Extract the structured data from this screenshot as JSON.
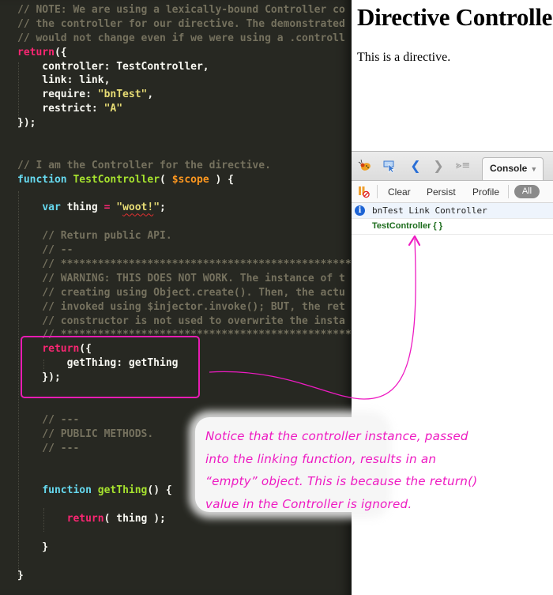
{
  "editor": {
    "lines": [
      [
        {
          "t": "// NOTE: We are using a lexically-bound Controller co",
          "k": "c"
        }
      ],
      [
        {
          "t": "// the controller for our directive. The demonstrated",
          "k": "c"
        }
      ],
      [
        {
          "t": "// would not change even if we were using a .controll",
          "k": "c"
        }
      ],
      [
        {
          "t": "return",
          "k": "kw"
        },
        {
          "t": "({",
          "k": ""
        }
      ],
      [
        {
          "t": "    controller: TestController,",
          "k": ""
        }
      ],
      [
        {
          "t": "    link: link,",
          "k": ""
        }
      ],
      [
        {
          "t": "    require: ",
          "k": ""
        },
        {
          "t": "\"bnTest\"",
          "k": "st"
        },
        {
          "t": ",",
          "k": ""
        }
      ],
      [
        {
          "t": "    restrict: ",
          "k": ""
        },
        {
          "t": "\"A\"",
          "k": "st"
        }
      ],
      [
        {
          "t": "});",
          "k": ""
        }
      ],
      [],
      [],
      [
        {
          "t": "// I am the Controller for the directive.",
          "k": "c"
        }
      ],
      [
        {
          "t": "function",
          "k": "fn"
        },
        {
          "t": " ",
          "k": ""
        },
        {
          "t": "TestController",
          "k": "nm"
        },
        {
          "t": "( ",
          "k": ""
        },
        {
          "t": "$scope",
          "k": "pm"
        },
        {
          "t": " ) {",
          "k": ""
        }
      ],
      [],
      [
        {
          "t": "    ",
          "k": ""
        },
        {
          "t": "var",
          "k": "fn"
        },
        {
          "t": " thing ",
          "k": ""
        },
        {
          "t": "=",
          "k": "op"
        },
        {
          "t": " ",
          "k": ""
        },
        {
          "t": "\"",
          "k": "st"
        },
        {
          "t": "woot!",
          "k": "st sq"
        },
        {
          "t": "\"",
          "k": "st"
        },
        {
          "t": ";",
          "k": ""
        }
      ],
      [],
      [
        {
          "t": "    // Return public API.",
          "k": "c"
        }
      ],
      [
        {
          "t": "    // --",
          "k": "c"
        }
      ],
      [
        {
          "t": "    // ****************************************************",
          "k": "c"
        }
      ],
      [
        {
          "t": "    // WARNING: THIS DOES NOT WORK. The instance of t",
          "k": "c"
        }
      ],
      [
        {
          "t": "    // creating using Object.create(). Then, the actu",
          "k": "c"
        }
      ],
      [
        {
          "t": "    // invoked using $injector.invoke(); BUT, the ret",
          "k": "c"
        }
      ],
      [
        {
          "t": "    // constructor is not used to overwrite the insta",
          "k": "c"
        }
      ],
      [
        {
          "t": "    // ****************************************************",
          "k": "c"
        }
      ],
      [
        {
          "t": "    ",
          "k": ""
        },
        {
          "t": "return",
          "k": "kw"
        },
        {
          "t": "({",
          "k": ""
        }
      ],
      [
        {
          "t": "        getThing: getThing",
          "k": ""
        }
      ],
      [
        {
          "t": "    });",
          "k": ""
        }
      ],
      [],
      [],
      [
        {
          "t": "    // ---",
          "k": "c"
        }
      ],
      [
        {
          "t": "    // PUBLIC METHODS.",
          "k": "c"
        }
      ],
      [
        {
          "t": "    // ---",
          "k": "c"
        }
      ],
      [],
      [],
      [
        {
          "t": "    ",
          "k": ""
        },
        {
          "t": "function",
          "k": "fn"
        },
        {
          "t": " ",
          "k": ""
        },
        {
          "t": "getThing",
          "k": "nm"
        },
        {
          "t": "() {",
          "k": ""
        }
      ],
      [],
      [
        {
          "t": "        ",
          "k": ""
        },
        {
          "t": "return",
          "k": "kw"
        },
        {
          "t": "( thing );",
          "k": ""
        }
      ],
      [],
      [
        {
          "t": "    }",
          "k": ""
        }
      ],
      [],
      [
        {
          "t": "}",
          "k": ""
        }
      ]
    ]
  },
  "browser": {
    "page_title": "Directive Controller",
    "page_text": "This is a directive."
  },
  "devtools": {
    "icons": [
      "firebug-icon",
      "inspect-icon",
      "back-icon",
      "forward-icon",
      "command-line-icon"
    ],
    "active_tab": "Console",
    "subbar": {
      "clear": "Clear",
      "persist": "Persist",
      "profile": "Profile",
      "filter_all": "All"
    },
    "logs": [
      {
        "type": "info",
        "text": "bnTest Link Controller"
      },
      {
        "type": "object",
        "text": "TestController {  }"
      }
    ]
  },
  "annotation": {
    "lines": [
      "Notice that the controller instance, passed",
      "into the linking function, results in an",
      "“empty” object. This is because the return()",
      "value in the Controller is ignored."
    ],
    "color": "#ee1bc2"
  },
  "colors": {
    "editor_bg": "#272822",
    "comment": "#75715e",
    "keyword": "#f92672",
    "function_kw": "#66d9ef",
    "name": "#a6e22e",
    "string": "#e6db74",
    "param": "#fd971f",
    "highlight": "#e81cb3"
  }
}
